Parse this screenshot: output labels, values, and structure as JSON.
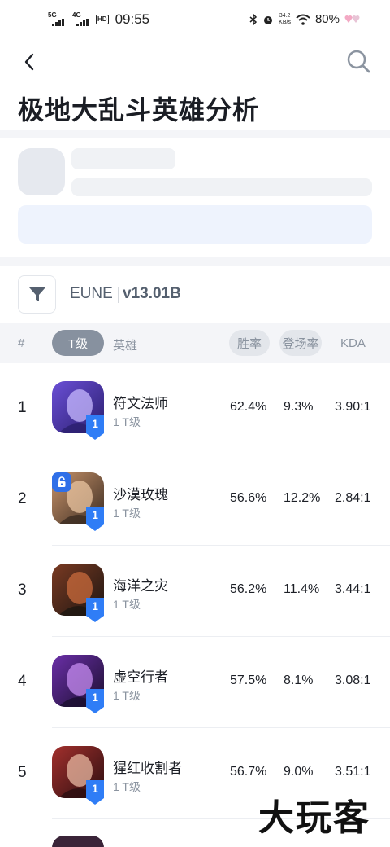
{
  "status_bar": {
    "net1": "5G",
    "net2": "4G",
    "hd": "HD",
    "time": "09:55",
    "speed_value": "34.2",
    "speed_unit": "KB/s",
    "battery": "80%"
  },
  "header": {
    "title": "极地大乱斗英雄分析"
  },
  "filter": {
    "region": "EUNE",
    "version": "v13.01B"
  },
  "table_header": {
    "rank": "#",
    "tier": "T级",
    "hero": "英雄",
    "winrate": "胜率",
    "pickrate": "登场率",
    "kda": "KDA"
  },
  "rows": [
    {
      "rank": "1",
      "name": "符文法师",
      "tier": "1 T级",
      "tier_num": "1",
      "winrate": "62.4%",
      "pickrate": "9.3%",
      "kda": "3.90:1",
      "locked": false,
      "colors": [
        "#2b1f6e",
        "#6a4fd6",
        "#c7b9ff"
      ]
    },
    {
      "rank": "2",
      "name": "沙漠玫瑰",
      "tier": "1 T级",
      "tier_num": "1",
      "winrate": "56.6%",
      "pickrate": "12.2%",
      "kda": "2.84:1",
      "locked": true,
      "colors": [
        "#3b2c22",
        "#c8936a",
        "#eac4a0"
      ]
    },
    {
      "rank": "3",
      "name": "海洋之灾",
      "tier": "1 T级",
      "tier_num": "1",
      "winrate": "56.2%",
      "pickrate": "11.4%",
      "kda": "3.44:1",
      "locked": false,
      "colors": [
        "#1d1612",
        "#7a3a22",
        "#c96b3c"
      ]
    },
    {
      "rank": "4",
      "name": "虚空行者",
      "tier": "1 T级",
      "tier_num": "1",
      "winrate": "57.5%",
      "pickrate": "8.1%",
      "kda": "3.08:1",
      "locked": false,
      "colors": [
        "#1a0f2e",
        "#6b2fa8",
        "#c58cf0"
      ]
    },
    {
      "rank": "5",
      "name": "猩红收割者",
      "tier": "1 T级",
      "tier_num": "1",
      "winrate": "56.7%",
      "pickrate": "9.0%",
      "kda": "3.51:1",
      "locked": false,
      "colors": [
        "#2a0e10",
        "#a3302d",
        "#e8b8a2"
      ]
    }
  ],
  "watermark": "大玩客",
  "theme": {
    "accent": "#2f7df6",
    "pill_active": "#87919f"
  }
}
